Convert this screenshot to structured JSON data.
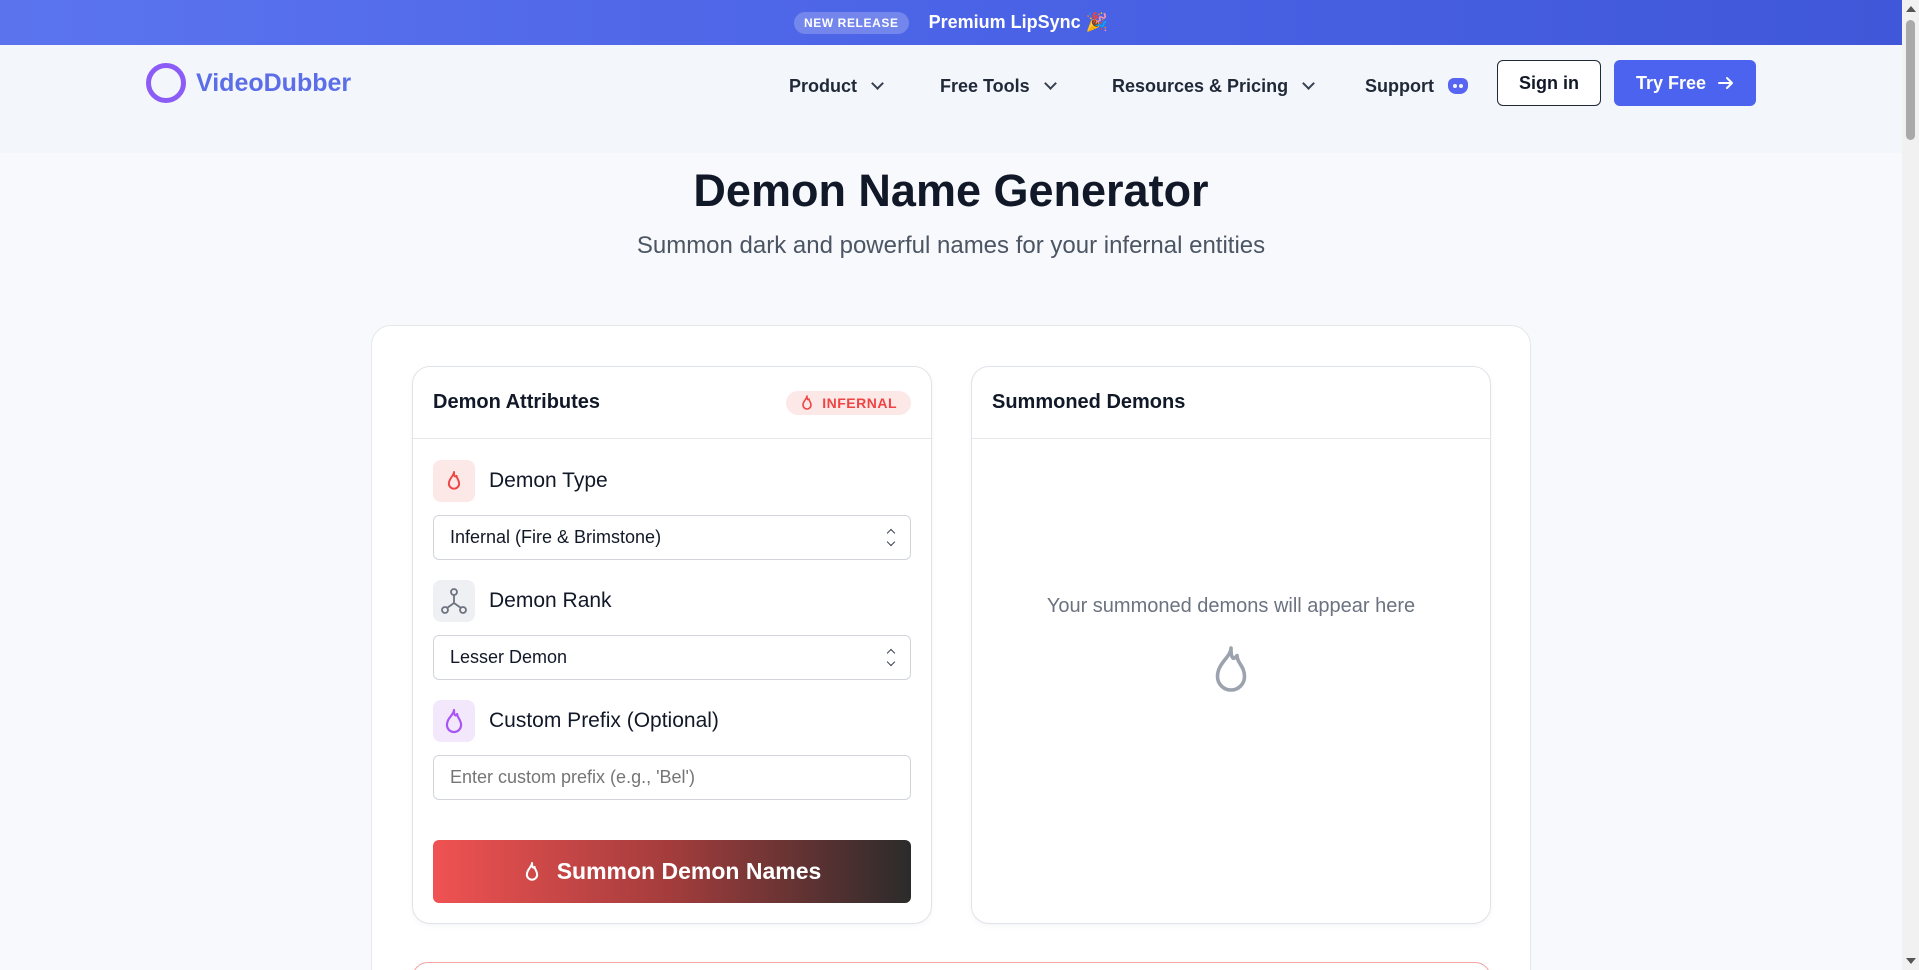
{
  "banner": {
    "badge": "NEW RELEASE",
    "text": "Premium LipSync 🎉"
  },
  "nav": {
    "logo_text": "VideoDubber",
    "items": [
      {
        "label": "Product"
      },
      {
        "label": "Free Tools"
      },
      {
        "label": "Resources & Pricing"
      },
      {
        "label": "Support"
      }
    ],
    "signin_label": "Sign in",
    "try_label": "Try Free"
  },
  "hero": {
    "title": "Demon Name Generator",
    "subtitle": "Summon dark and powerful names for your infernal entities"
  },
  "attributes": {
    "title": "Demon Attributes",
    "badge": "INFERNAL",
    "type_label": "Demon Type",
    "type_value": "Infernal (Fire & Brimstone)",
    "rank_label": "Demon Rank",
    "rank_value": "Lesser Demon",
    "prefix_label": "Custom Prefix (Optional)",
    "prefix_placeholder": "Enter custom prefix (e.g., 'Bel')",
    "summon_label": "Summon Demon Names"
  },
  "results": {
    "title": "Summoned Demons",
    "empty_text": "Your summoned demons will appear here"
  },
  "colors": {
    "accent": "#4b63ee",
    "danger": "#ef4444",
    "logo": "#8b5cf6"
  }
}
